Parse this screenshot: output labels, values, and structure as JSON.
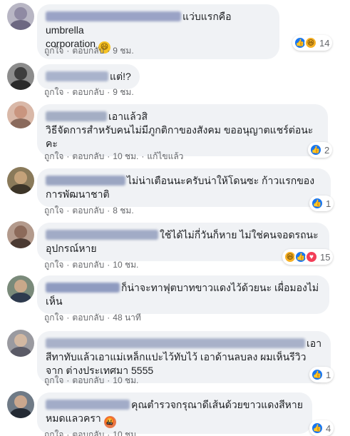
{
  "action_labels": {
    "like": "ถูกใจ",
    "reply": "ตอบกลับ",
    "edited": "แก้ไขแล้ว"
  },
  "comments": [
    {
      "text": "แว่บแรกคือ umbrella\ncorporation",
      "emoji": "😄",
      "time": "9 ชม.",
      "reaction_count": "14",
      "reactions": [
        "like",
        "haha"
      ]
    },
    {
      "text": "แต่!?",
      "time": "9 ชม."
    },
    {
      "text": "เอาแล้วสิ\nวิธีจัดการสำหรับคนไม่มีภูกติกาของสังคม ขออนุญาตแชร์ต่อนะ\nคะ",
      "time": "10 ชม.",
      "edited": true,
      "reaction_count": "2",
      "reactions": [
        "like"
      ]
    },
    {
      "text": "ไม่น่าเตือนนะครับน่าให้โดนซะ ก้าวแรกของ\nการพัฒนาชาติ",
      "time": "8 ชม.",
      "reaction_count": "1",
      "reactions": [
        "like"
      ]
    },
    {
      "text": "ใช้ได้ไม่กี่วันก็หาย ไม่ใช่คนจอดรถนะ\nอุปกรณ์หาย",
      "time": "10 ชม.",
      "reaction_count": "15",
      "reactions": [
        "haha",
        "like",
        "love"
      ]
    },
    {
      "text": "ก็น่าจะทาฟุตบาทขาวแดงไว้ด้วยนะ เผื่อมองไม่\nเห็น",
      "time": "48 นาที"
    },
    {
      "text": "เอา\nสีทาทับแล้วเอาแม่เหล็กแปะไว้ทับไว้ เอาด้านลบลง ผมเห็นรีวิว\nจาก ต่างประเทศมา 5555",
      "time": "10 ชม.",
      "reaction_count": "1",
      "reactions": [
        "like"
      ]
    },
    {
      "text": "คุณตำรวจกรุณาดีเส้นด้วยขาวแดงสีหาย\nหมดแลวครา",
      "emoji": "🤬",
      "time": "10 ชม.",
      "reaction_count": "4",
      "reactions": [
        "like"
      ]
    }
  ],
  "colors": {
    "bubble": "#f0f2f5",
    "meta": "#65676b",
    "like": "#1877f2",
    "haha": "#f7b125",
    "love": "#f33e58"
  }
}
